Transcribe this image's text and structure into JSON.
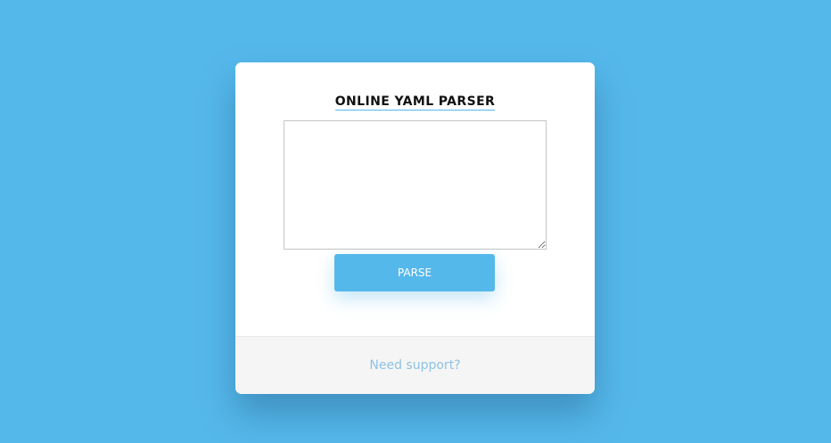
{
  "header": {
    "title": "ONLINE YAML PARSER"
  },
  "editor": {
    "value": "",
    "placeholder": ""
  },
  "actions": {
    "parse_label": "PARSE"
  },
  "footer": {
    "support_label": "Need support?"
  },
  "colors": {
    "background": "#55b8eb",
    "accent": "#55b8eb",
    "card": "#ffffff",
    "footer": "#f5f5f5",
    "link": "#8ec3e2"
  }
}
